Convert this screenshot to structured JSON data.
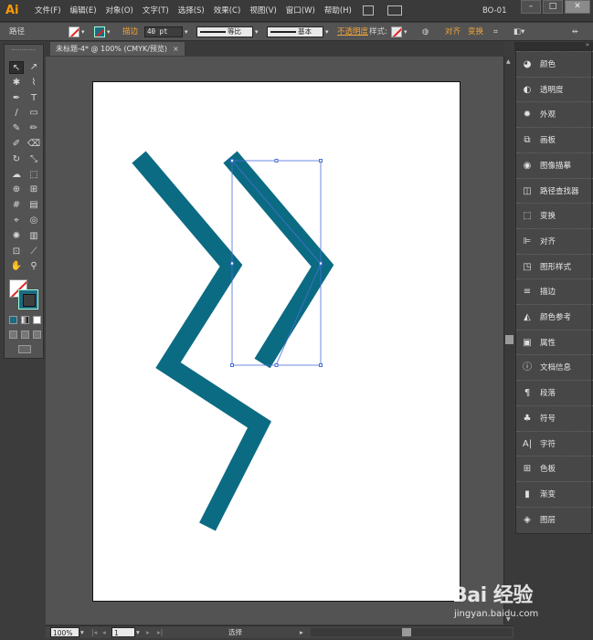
{
  "app": {
    "logo": "Ai",
    "document_name": "BO-01"
  },
  "menu": [
    "文件(F)",
    "编辑(E)",
    "对象(O)",
    "文字(T)",
    "选择(S)",
    "效果(C)",
    "视图(V)",
    "窗口(W)",
    "帮助(H)"
  ],
  "window_controls": {
    "minimize": "–",
    "maximize": "□",
    "close": "✕"
  },
  "controlbar": {
    "object_type": "路径",
    "stroke_label": "描边",
    "stroke_weight": "40 pt",
    "profile_label": "等比",
    "brush_label": "基本",
    "opacity_label": "不透明度",
    "style_label": "样式:",
    "align_label": "对齐",
    "transform_label": "变换"
  },
  "tab": {
    "title": "未标题-4* @ 100% (CMYK/预览)",
    "close": "×"
  },
  "tools": [
    {
      "name": "selection-tool",
      "glyph": "↖"
    },
    {
      "name": "direct-selection-tool",
      "glyph": "↗"
    },
    {
      "name": "magic-wand-tool",
      "glyph": "✱"
    },
    {
      "name": "lasso-tool",
      "glyph": "⌇"
    },
    {
      "name": "pen-tool",
      "glyph": "✒"
    },
    {
      "name": "type-tool",
      "glyph": "T"
    },
    {
      "name": "line-tool",
      "glyph": "/"
    },
    {
      "name": "rectangle-tool",
      "glyph": "▭"
    },
    {
      "name": "paintbrush-tool",
      "glyph": "✎"
    },
    {
      "name": "pencil-tool",
      "glyph": "✏"
    },
    {
      "name": "blob-brush-tool",
      "glyph": "✐"
    },
    {
      "name": "eraser-tool",
      "glyph": "⌫"
    },
    {
      "name": "rotate-tool",
      "glyph": "↻"
    },
    {
      "name": "scale-tool",
      "glyph": "⤡"
    },
    {
      "name": "warp-tool",
      "glyph": "☁"
    },
    {
      "name": "free-transform-tool",
      "glyph": "⬚"
    },
    {
      "name": "shape-builder-tool",
      "glyph": "⊕"
    },
    {
      "name": "perspective-grid-tool",
      "glyph": "⊞"
    },
    {
      "name": "mesh-tool",
      "glyph": "#"
    },
    {
      "name": "gradient-tool",
      "glyph": "▤"
    },
    {
      "name": "eyedropper-tool",
      "glyph": "⌖"
    },
    {
      "name": "blend-tool",
      "glyph": "◎"
    },
    {
      "name": "symbol-sprayer-tool",
      "glyph": "✺"
    },
    {
      "name": "column-graph-tool",
      "glyph": "▥"
    },
    {
      "name": "artboard-tool",
      "glyph": "⊡"
    },
    {
      "name": "slice-tool",
      "glyph": "⟋"
    },
    {
      "name": "hand-tool",
      "glyph": "✋"
    },
    {
      "name": "zoom-tool",
      "glyph": "⚲"
    }
  ],
  "colors": {
    "shape_fill": "#0b6b83",
    "selection": "#4a6fd8",
    "fill_none_slash": "#e3221f"
  },
  "dock": [
    {
      "name": "color",
      "label": "颜色",
      "glyph": "◕"
    },
    {
      "name": "transparency",
      "label": "透明度",
      "glyph": "◐"
    },
    {
      "name": "appearance",
      "label": "外观",
      "glyph": "✹"
    },
    {
      "name": "artboards",
      "label": "画板",
      "glyph": "⧉"
    },
    {
      "name": "image-trace",
      "label": "图像描摹",
      "glyph": "◉"
    },
    {
      "name": "pathfinder",
      "label": "路径查找器",
      "glyph": "◫"
    },
    {
      "name": "transform",
      "label": "变换",
      "glyph": "⬚"
    },
    {
      "name": "align",
      "label": "对齐",
      "glyph": "⊫"
    },
    {
      "name": "graphic-styles",
      "label": "图形样式",
      "glyph": "◳"
    },
    {
      "name": "stroke",
      "label": "描边",
      "glyph": "≡"
    },
    {
      "name": "color-guide",
      "label": "颜色参考",
      "glyph": "◭"
    },
    {
      "name": "attributes",
      "label": "属性",
      "glyph": "▣"
    },
    {
      "name": "document-info",
      "label": "文档信息",
      "glyph": "ⓘ"
    },
    {
      "name": "paragraph",
      "label": "段落",
      "glyph": "¶"
    },
    {
      "name": "symbols",
      "label": "符号",
      "glyph": "♣"
    },
    {
      "name": "character",
      "label": "字符",
      "glyph": "A|"
    },
    {
      "name": "swatches",
      "label": "色板",
      "glyph": "⊞"
    },
    {
      "name": "gradient",
      "label": "渐变",
      "glyph": "▮"
    },
    {
      "name": "layers",
      "label": "图层",
      "glyph": "◈"
    }
  ],
  "status": {
    "zoom": "100%",
    "artboard_number": "1",
    "tool_name": "选择"
  },
  "watermark": {
    "brand": "Bai 经验",
    "url": "jingyan.baidu.com"
  }
}
